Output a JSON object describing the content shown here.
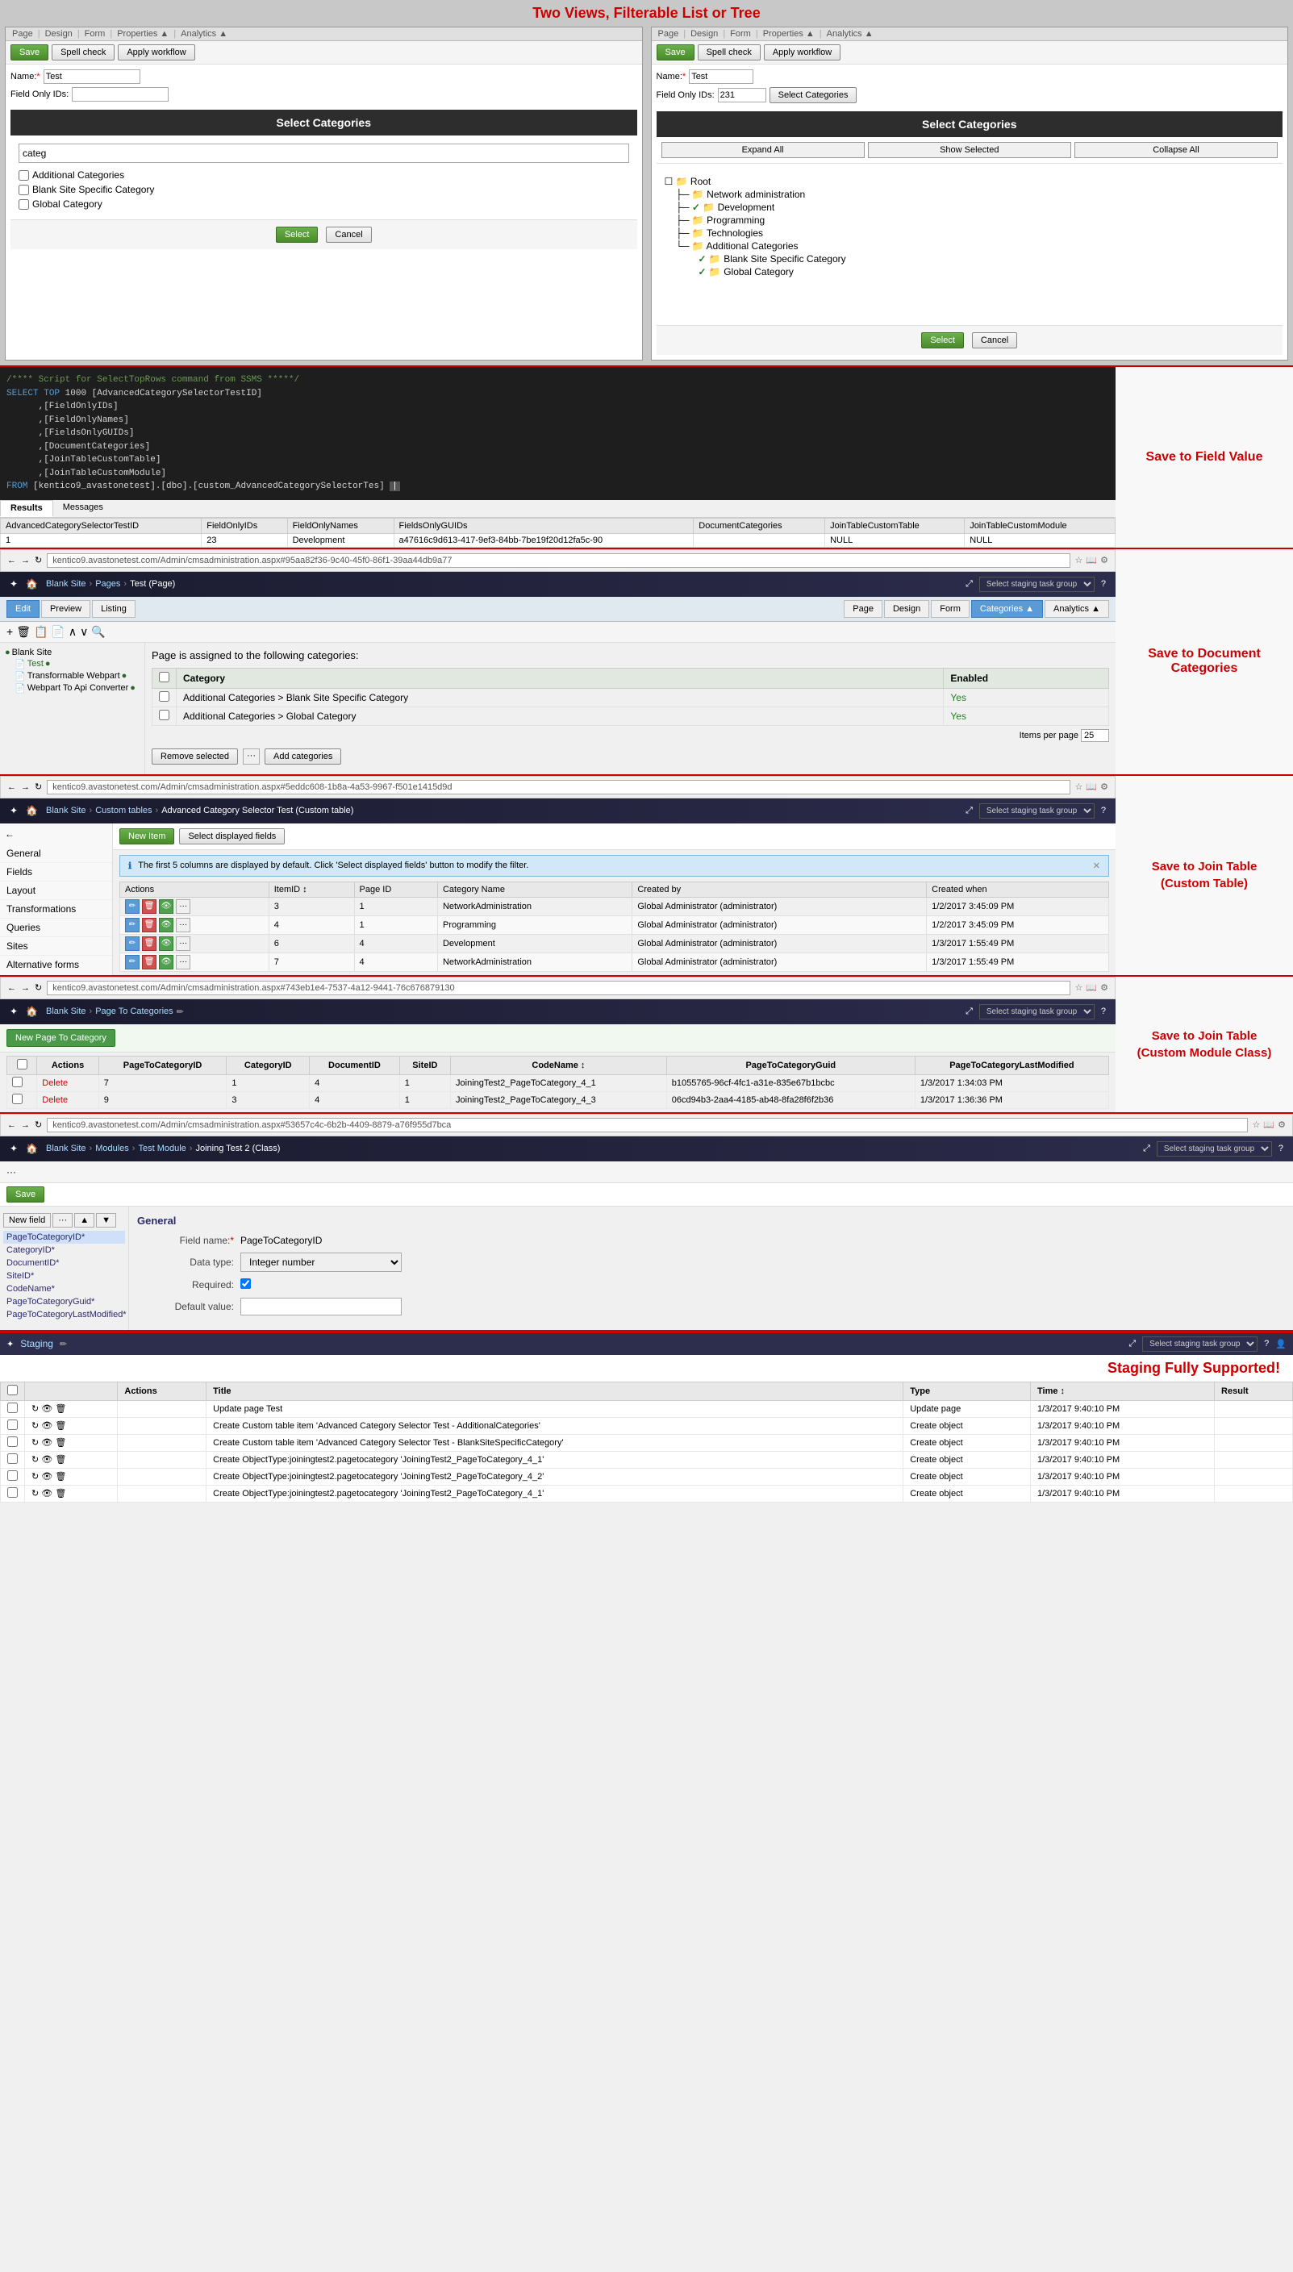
{
  "annotations": {
    "two_views": "Two Views, Filterable List or Tree",
    "save_field": "Save to Field Value",
    "save_doc_categories": "Save to Document Categories",
    "save_join_custom": "Save to Join Table\n(Custom Table)",
    "save_join_module": "Save to Join Table\n(Custom Module Class)",
    "staging": "Staging Fully Supported!"
  },
  "panel_left": {
    "dialog_title": "Select Categories",
    "search_placeholder": "categ",
    "items": [
      {
        "label": "Additional Categories",
        "checked": false
      },
      {
        "label": "Blank Site Specific Category",
        "checked": false
      },
      {
        "label": "Global Category",
        "checked": false
      }
    ],
    "btn_select": "Select",
    "btn_cancel": "Cancel"
  },
  "panel_right": {
    "dialog_title": "Select Categories",
    "btn_expand": "Expand All",
    "btn_show_selected": "Show Selected",
    "btn_collapse": "Collapse All",
    "tree": {
      "root": "Root",
      "nodes": [
        {
          "label": "Network administration",
          "level": 1,
          "checked": false,
          "icon": "folder"
        },
        {
          "label": "Development",
          "level": 1,
          "checked": true,
          "icon": "folder"
        },
        {
          "label": "Programming",
          "level": 1,
          "checked": false,
          "icon": "folder"
        },
        {
          "label": "Technologies",
          "level": 1,
          "checked": false,
          "icon": "folder"
        },
        {
          "label": "Additional Categories",
          "level": 1,
          "checked": false,
          "icon": "folder"
        },
        {
          "label": "Blank Site Specific Category",
          "level": 2,
          "checked": true,
          "icon": "folder"
        },
        {
          "label": "Global Category",
          "level": 2,
          "checked": true,
          "icon": "folder"
        }
      ]
    },
    "btn_select": "Select",
    "btn_cancel": "Cancel"
  },
  "nav_left": {
    "items": [
      "Page",
      "Design",
      "Form",
      "Properties ▲",
      "Analytics ▲"
    ]
  },
  "nav_right": {
    "items": [
      "Page",
      "Design",
      "Form",
      "Properties ▲",
      "Analytics ▲"
    ]
  },
  "toolbar_left": {
    "save": "Save",
    "spell_check": "Spell check",
    "apply_workflow": "Apply workflow"
  },
  "toolbar_right": {
    "save": "Save",
    "spell_check": "Spell check",
    "apply_workflow": "Apply workflow"
  },
  "sql": {
    "comment": "/**** Script for SelectTopRows command from SSMS *****/",
    "line1": "SELECT TOP 1000 [AdvancedCategorySelectorTestID]",
    "line2": "      ,[FieldOnlyIDs]",
    "line3": "      ,[FieldOnlyNames]",
    "line4": "      ,[FieldsOnlyGUIDs]",
    "line5": "      ,[DocumentCategories]",
    "line6": "      ,[JoinTableCustomTable]",
    "line7": "      ,[JoinTableCustomModule]",
    "line8": "FROM [kentico9_avastonetest].[dbo].[custom_AdvancedCategorySelectorTes]"
  },
  "results_tabs": [
    "Results",
    "Messages"
  ],
  "results_table": {
    "headers": [
      "AdvancedCategorySelectorTestID",
      "FieldOnlyIDs",
      "FieldOnlyNames",
      "FieldsOnlyGUIDs",
      "DocumentCategories",
      "JoinTableCustomTable",
      "JoinTableCustomModule"
    ],
    "rows": [
      [
        "1",
        "23",
        "Development",
        "a47616c9d613-417-9ef3-84bb-7be19f20d12fa5c-90",
        "",
        "NULL",
        "NULL"
      ]
    ]
  },
  "browser1": {
    "url": "kentico9.avastonetest.com/Admin/cmsadministration.aspx#95aa82f36-9c40-45f0-86f1-39aa44db9a77"
  },
  "kc1": {
    "logo": "☆",
    "home": "🏠",
    "site": "Blank Site",
    "breadcrumb": [
      "Pages",
      "Test (Page)"
    ],
    "staging_label": "Select staging task group",
    "help": "?"
  },
  "page_edit": {
    "tabs": [
      "Edit",
      "Preview",
      "Listing"
    ],
    "form_tabs": [
      "Page",
      "Design",
      "Form",
      "Categories ▲",
      "Analytics ▲"
    ]
  },
  "categories_section": {
    "title": "Page is assigned to the following categories:",
    "headers": [
      "Category",
      "Enabled"
    ],
    "rows": [
      {
        "name": "Additional Categories > Blank Site Specific Category",
        "enabled": "Yes"
      },
      {
        "name": "Additional Categories > Global Category",
        "enabled": "Yes"
      }
    ],
    "items_per_page": "Items per page",
    "page_size": "25",
    "btn_remove": "Remove selected",
    "btn_add": "Add categories"
  },
  "browser2": {
    "url": "kentico9.avastonetest.com/Admin/cmsadministration.aspx#5eddc608-1b8a-4a53-9967-f501e1415d9d"
  },
  "kc2": {
    "site": "Blank Site",
    "breadcrumb": [
      "Custom tables",
      "Advanced Category Selector Test (Custom table)"
    ],
    "staging_label": "Select staging task group"
  },
  "custom_table": {
    "sidebar": [
      "General",
      "Fields",
      "Layout",
      "Transformations",
      "Queries",
      "Sites",
      "Alternative forms"
    ],
    "btn_new_item": "New Item",
    "btn_select_fields": "Select displayed fields",
    "info_text": "The first 5 columns are displayed by default. Click 'Select displayed fields' button to modify the filter.",
    "headers": [
      "Actions",
      "ItemID ↕",
      "Page ID",
      "Category Name",
      "Created by",
      "Created when"
    ],
    "rows": [
      {
        "itemid": "3",
        "pageid": "1",
        "category": "NetworkAdministration",
        "created_by": "Global Administrator (administrator)",
        "created_when": "1/2/2017 3:45:09 PM"
      },
      {
        "itemid": "4",
        "pageid": "1",
        "category": "Programming",
        "created_by": "Global Administrator (administrator)",
        "created_when": "1/2/2017 3:45:09 PM"
      },
      {
        "itemid": "6",
        "pageid": "4",
        "category": "Development",
        "created_by": "Global Administrator (administrator)",
        "created_when": "1/3/2017 1:55:49 PM"
      },
      {
        "itemid": "7",
        "pageid": "4",
        "category": "NetworkAdministration",
        "created_by": "Global Administrator (administrator)",
        "created_when": "1/3/2017 1:55:49 PM"
      }
    ]
  },
  "browser3": {
    "url": "kentico9.avastonetest.com/Admin/cmsadministration.aspx#743eb1e4-7537-4a12-9441-76c676879130"
  },
  "kc3": {
    "site": "Blank Site",
    "breadcrumb": [
      "Page To Categories"
    ],
    "staging_label": "Select staging task group"
  },
  "page_to_category": {
    "btn_new": "New Page To Category",
    "headers": [
      "Actions",
      "PageToCategoryID",
      "CategoryID",
      "DocumentID",
      "SiteID",
      "CodeName ↕",
      "PageToCategoryGuid",
      "PageToCategoryLastModified"
    ],
    "rows": [
      {
        "actions": "Delete",
        "ptcid": "7",
        "catid": "1",
        "docid": "4",
        "siteid": "1",
        "codename": "JoiningTest2_PageToCategory_4_1",
        "guid": "b1055765-96cf-4fc1-a31e-835e67b1bcbc",
        "modified": "1/3/2017 1:34:03 PM"
      },
      {
        "actions": "Delete",
        "ptcid": "9",
        "catid": "3",
        "docid": "4",
        "siteid": "1",
        "codename": "JoiningTest2_PageToCategory_4_3",
        "guid": "06cd94b3-2aa4-4185-ab48-8fa28f6f2b36",
        "modified": "1/3/2017 1:36:36 PM"
      }
    ]
  },
  "browser4": {
    "url": "kentico9.avastonetest.com/Admin/cmsadministration.aspx#53657c4c-6b2b-4409-8879-a76f955d7bca"
  },
  "kc4": {
    "site": "Blank Site",
    "breadcrumb": [
      "Modules",
      "Test Module",
      "Joining Test 2 (Class)"
    ],
    "staging_label": "Select staging task group"
  },
  "module_class": {
    "btn_save": "Save",
    "fields": [
      "PageToCategoryID*",
      "CategoryID*",
      "DocumentID*",
      "SiteID*",
      "CodeName*",
      "PageToCategoryGuid*",
      "PageToCategoryLastModified*"
    ],
    "field_tools": [
      "New field",
      "...",
      "▲",
      "▼"
    ],
    "general_label": "General",
    "form": {
      "field_name_label": "Field name:",
      "field_name_value": "PageToCategoryID",
      "data_type_label": "Data type:",
      "data_type_value": "Integer number",
      "required_label": "Required:",
      "required_checked": true,
      "default_value_label": "Default value:"
    }
  },
  "staging_section": {
    "label": "Staging",
    "staging_link": "Select staging task group",
    "headers": [
      "Actions",
      "Title",
      "Type",
      "Time ↕",
      "Result"
    ],
    "rows": [
      {
        "title": "Update page Test",
        "type": "Update page",
        "time": "1/3/2017 9:40:10 PM",
        "result": ""
      },
      {
        "title": "Create Custom table item 'Advanced Category Selector Test - AdditionalCategories'",
        "type": "Create object",
        "time": "1/3/2017 9:40:10 PM",
        "result": ""
      },
      {
        "title": "Create Custom table item 'Advanced Category Selector Test - BlankSiteSpecificCategory'",
        "type": "Create object",
        "time": "1/3/2017 9:40:10 PM",
        "result": ""
      },
      {
        "title": "Create ObjectType:joiningtest2.pagetocategory 'JoiningTest2_PageToCategory_4_1'",
        "type": "Create object",
        "time": "1/3/2017 9:40:10 PM",
        "result": ""
      },
      {
        "title": "Create ObjectType:joiningtest2.pagetocategory 'JoiningTest2_PageToCategory_4_2'",
        "type": "Create object",
        "time": "1/3/2017 9:40:10 PM",
        "result": ""
      },
      {
        "title": "Create ObjectType:joiningtest2.pagetocategory 'JoiningTest2_PageToCategory_4_1'",
        "type": "Create object",
        "time": "1/3/2017 9:40:10 PM",
        "result": ""
      }
    ]
  }
}
